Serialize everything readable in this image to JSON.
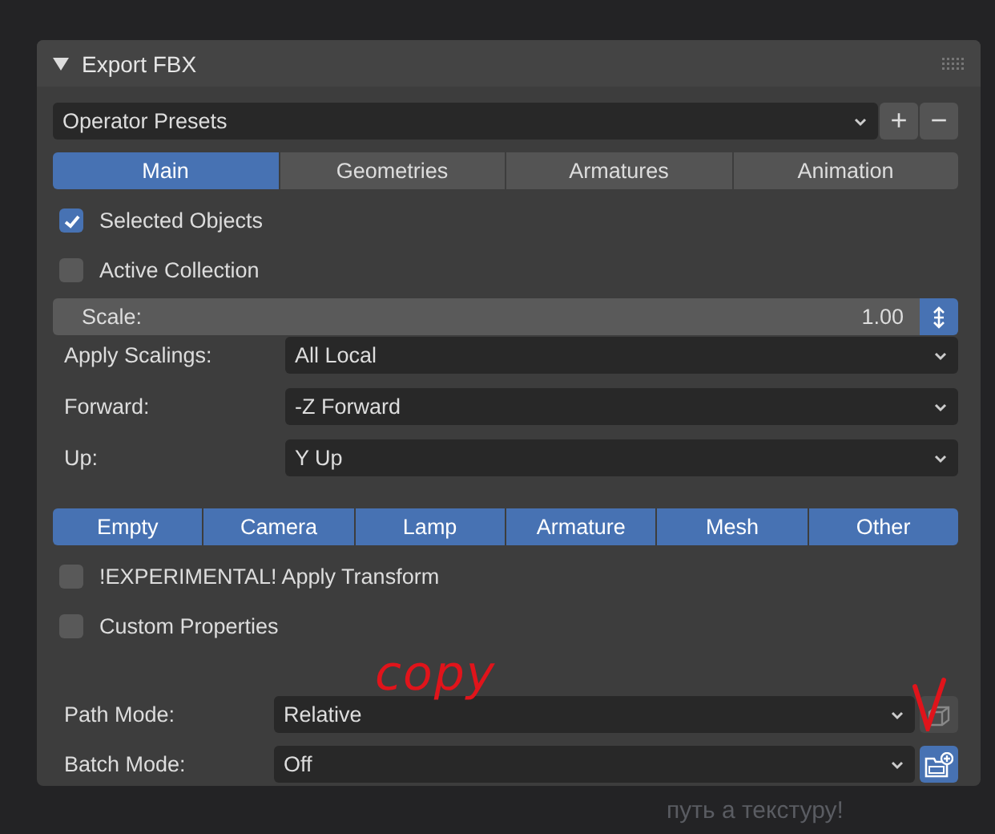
{
  "panel": {
    "title": "Export FBX",
    "expanded": true
  },
  "presets": {
    "value": "Operator Presets",
    "add": "+",
    "remove": "−"
  },
  "tabs": [
    {
      "label": "Main",
      "selected": true
    },
    {
      "label": "Geometries",
      "selected": false
    },
    {
      "label": "Armatures",
      "selected": false
    },
    {
      "label": "Animation",
      "selected": false
    }
  ],
  "checks_top": [
    {
      "label": "Selected Objects",
      "checked": true
    },
    {
      "label": "Active Collection",
      "checked": false
    }
  ],
  "scale": {
    "label": "Scale:",
    "value": "1.00",
    "toggle_on": true
  },
  "selects": [
    {
      "label": "Apply Scalings:",
      "value": "All Local"
    },
    {
      "label": "Forward:",
      "value": "-Z Forward"
    },
    {
      "label": "Up:",
      "value": "Y Up"
    }
  ],
  "object_types": [
    {
      "label": "Empty",
      "selected": true
    },
    {
      "label": "Camera",
      "selected": true
    },
    {
      "label": "Lamp",
      "selected": true
    },
    {
      "label": "Armature",
      "selected": true
    },
    {
      "label": "Mesh",
      "selected": true
    },
    {
      "label": "Other",
      "selected": true
    }
  ],
  "checks_bottom": [
    {
      "label": "!EXPERIMENTAL! Apply Transform",
      "checked": false
    },
    {
      "label": "Custom Properties",
      "checked": false
    }
  ],
  "path_mode": {
    "label": "Path Mode:",
    "value": "Relative",
    "embed_on": false
  },
  "batch_mode": {
    "label": "Batch Mode:",
    "value": "Off",
    "folder_on": true
  },
  "annotations": [
    {
      "kind": "word",
      "text": "copy"
    },
    {
      "kind": "tick"
    }
  ],
  "background_text": [
    "путь а текстуру!"
  ]
}
